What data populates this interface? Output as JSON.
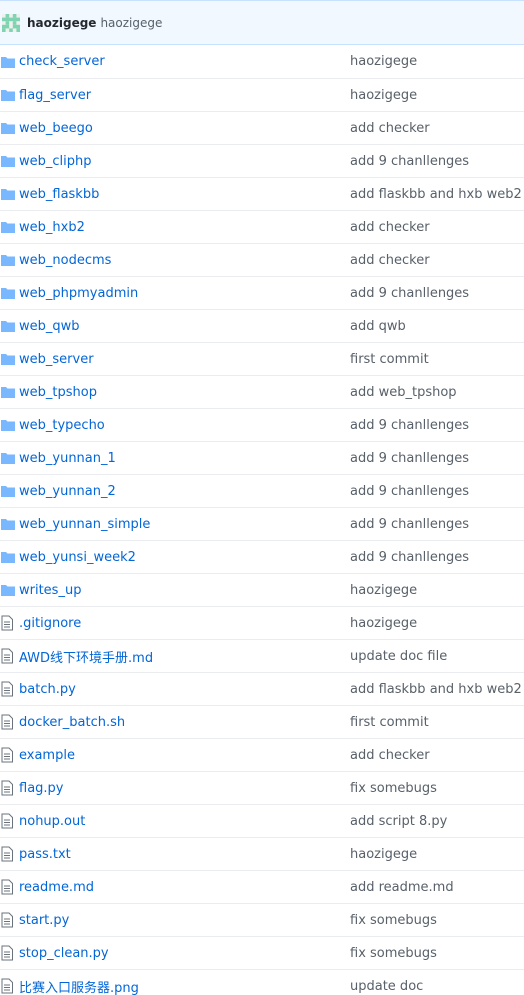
{
  "commit": {
    "author": "haozigege",
    "message": "haozigege"
  },
  "files": [
    {
      "type": "dir",
      "name": "check_server",
      "message": "haozigege"
    },
    {
      "type": "dir",
      "name": "flag_server",
      "message": "haozigege"
    },
    {
      "type": "dir",
      "name": "web_beego",
      "message": "add checker"
    },
    {
      "type": "dir",
      "name": "web_cliphp",
      "message": "add 9 chanllenges"
    },
    {
      "type": "dir",
      "name": "web_flaskbb",
      "message": "add flaskbb and hxb web2 in"
    },
    {
      "type": "dir",
      "name": "web_hxb2",
      "message": "add checker"
    },
    {
      "type": "dir",
      "name": "web_nodecms",
      "message": "add checker"
    },
    {
      "type": "dir",
      "name": "web_phpmyadmin",
      "message": "add 9 chanllenges"
    },
    {
      "type": "dir",
      "name": "web_qwb",
      "message": "add qwb"
    },
    {
      "type": "dir",
      "name": "web_server",
      "message": "first commit"
    },
    {
      "type": "dir",
      "name": "web_tpshop",
      "message": "add web_tpshop"
    },
    {
      "type": "dir",
      "name": "web_typecho",
      "message": "add 9 chanllenges"
    },
    {
      "type": "dir",
      "name": "web_yunnan_1",
      "message": "add 9 chanllenges"
    },
    {
      "type": "dir",
      "name": "web_yunnan_2",
      "message": "add 9 chanllenges"
    },
    {
      "type": "dir",
      "name": "web_yunnan_simple",
      "message": "add 9 chanllenges"
    },
    {
      "type": "dir",
      "name": "web_yunsi_week2",
      "message": "add 9 chanllenges"
    },
    {
      "type": "dir",
      "name": "writes_up",
      "message": "haozigege"
    },
    {
      "type": "file",
      "name": ".gitignore",
      "message": "haozigege"
    },
    {
      "type": "file",
      "name": "AWD线下环境手册.md",
      "message": "update doc file"
    },
    {
      "type": "file",
      "name": "batch.py",
      "message": "add flaskbb and hxb web2 in"
    },
    {
      "type": "file",
      "name": "docker_batch.sh",
      "message": "first commit"
    },
    {
      "type": "file",
      "name": "example",
      "message": "add checker"
    },
    {
      "type": "file",
      "name": "flag.py",
      "message": "fix somebugs"
    },
    {
      "type": "file",
      "name": "nohup.out",
      "message": "add script 8.py"
    },
    {
      "type": "file",
      "name": "pass.txt",
      "message": "haozigege"
    },
    {
      "type": "file",
      "name": "readme.md",
      "message": "add readme.md"
    },
    {
      "type": "file",
      "name": "start.py",
      "message": "fix somebugs"
    },
    {
      "type": "file",
      "name": "stop_clean.py",
      "message": "fix somebugs"
    },
    {
      "type": "file",
      "name": "比赛入口服务器.png",
      "message": "update doc"
    }
  ],
  "colors": {
    "link": "#0366d6",
    "folder": "#79b8ff",
    "header_bg": "#f1f8ff"
  }
}
